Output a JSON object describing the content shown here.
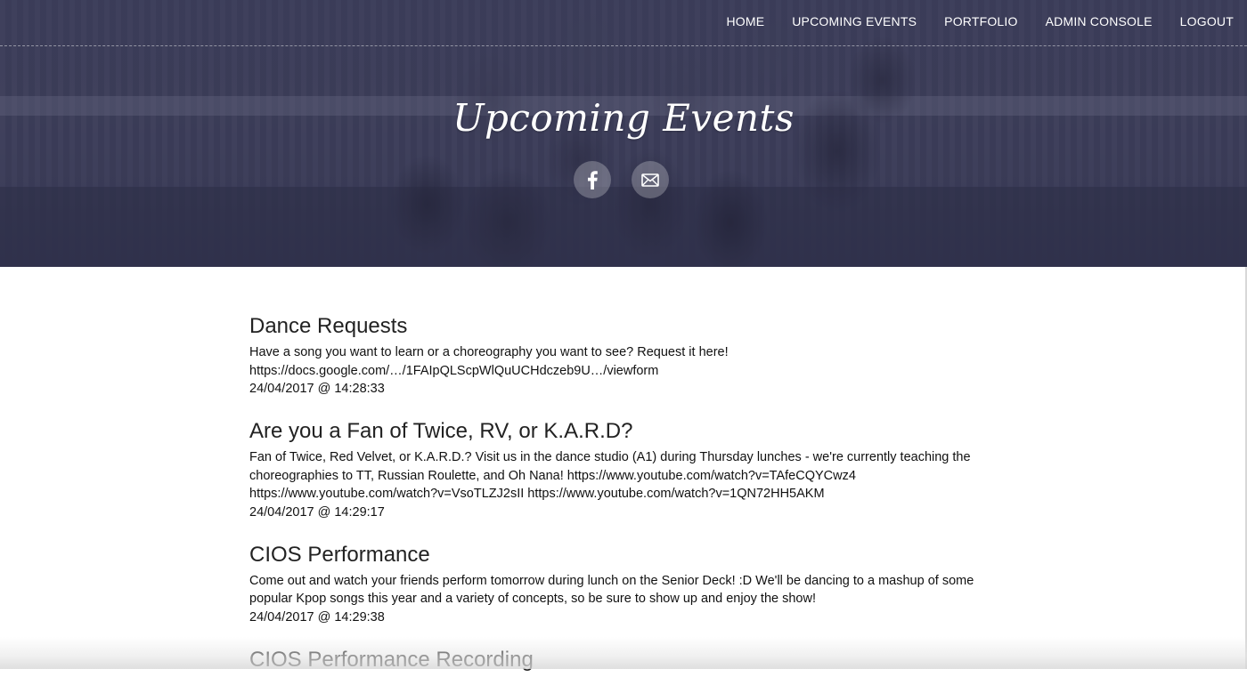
{
  "nav": {
    "items": [
      {
        "label": "HOME"
      },
      {
        "label": "UPCOMING EVENTS"
      },
      {
        "label": "PORTFOLIO"
      },
      {
        "label": "ADMIN CONSOLE"
      },
      {
        "label": "LOGOUT"
      }
    ]
  },
  "hero": {
    "title": "Upcoming Events",
    "social": [
      {
        "icon": "facebook-icon"
      },
      {
        "icon": "mail-icon"
      }
    ]
  },
  "events": [
    {
      "title": "Dance Requests",
      "description": "Have a song you want to learn or a choreography you want to see? Request it here! https://docs.google.com/…/1FAIpQLScpWlQuUCHdczeb9U…/viewform",
      "date": "24/04/2017 @ 14:28:33"
    },
    {
      "title": "Are you a Fan of Twice, RV, or K.A.R.D?",
      "description": "Fan of Twice, Red Velvet, or K.A.R.D.? Visit us in the dance studio (A1) during Thursday lunches - we're currently teaching the choreographies to TT, Russian Roulette, and Oh Nana! https://www.youtube.com/watch?v=TAfeCQYCwz4 https://www.youtube.com/watch?v=VsoTLZJ2sII https://www.youtube.com/watch?v=1QN72HH5AKM",
      "date": "24/04/2017 @ 14:29:17"
    },
    {
      "title": "CIOS Performance",
      "description": "Come out and watch your friends perform tomorrow during lunch on the Senior Deck! :D We'll be dancing to a mashup of some popular Kpop songs this year and a variety of concepts, so be sure to show up and enjoy the show!",
      "date": "24/04/2017 @ 14:29:38"
    },
    {
      "title": "CIOS Performance Recording",
      "description": "",
      "date": ""
    }
  ]
}
